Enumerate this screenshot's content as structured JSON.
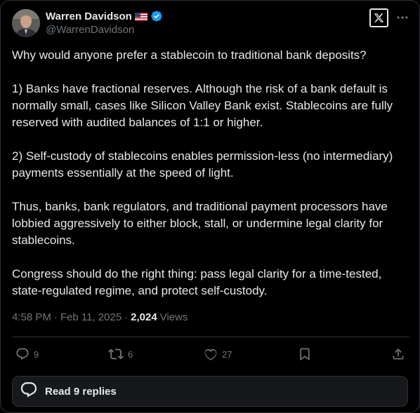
{
  "author": {
    "name": "Warren Davidson",
    "handle": "@WarrenDavidson"
  },
  "post": {
    "paragraphs": [
      "Why would anyone prefer a stablecoin to traditional bank deposits?",
      "1) Banks have fractional reserves. Although the risk of a bank default is\nnormally small, cases like Silicon Valley Bank exist. Stablecoins are fully\nreserved with audited balances of 1:1 or higher.",
      "2) Self-custody of stablecoins enables permission-less (no intermediary)\npayments essentially at the speed of light.",
      "Thus, banks, bank regulators,  and traditional payment processors have\nlobbied aggressively to either block, stall, or undermine legal clarity for\nstablecoins.",
      "Congress should do the right thing: pass legal clarity for a time-tested,\nstate-regulated regime, and protect self-custody."
    ],
    "time": "4:58 PM",
    "date": "Feb 11, 2025",
    "separator": "·",
    "views_count": "2,024",
    "views_label": "Views"
  },
  "actions": {
    "replies": "9",
    "reposts": "6",
    "likes": "27"
  },
  "read_replies_label": "Read 9 replies",
  "colors": {
    "background": "#000000",
    "text": "#e7e9ea",
    "muted": "#71767b",
    "border": "#2f3336",
    "verified": "#1d9bf0"
  },
  "icons": [
    "flag-us-icon",
    "verified-badge-icon",
    "x-logo-icon",
    "more-icon",
    "reply-icon",
    "repost-icon",
    "like-icon",
    "bookmark-icon",
    "share-icon",
    "speech-bubble-icon"
  ]
}
